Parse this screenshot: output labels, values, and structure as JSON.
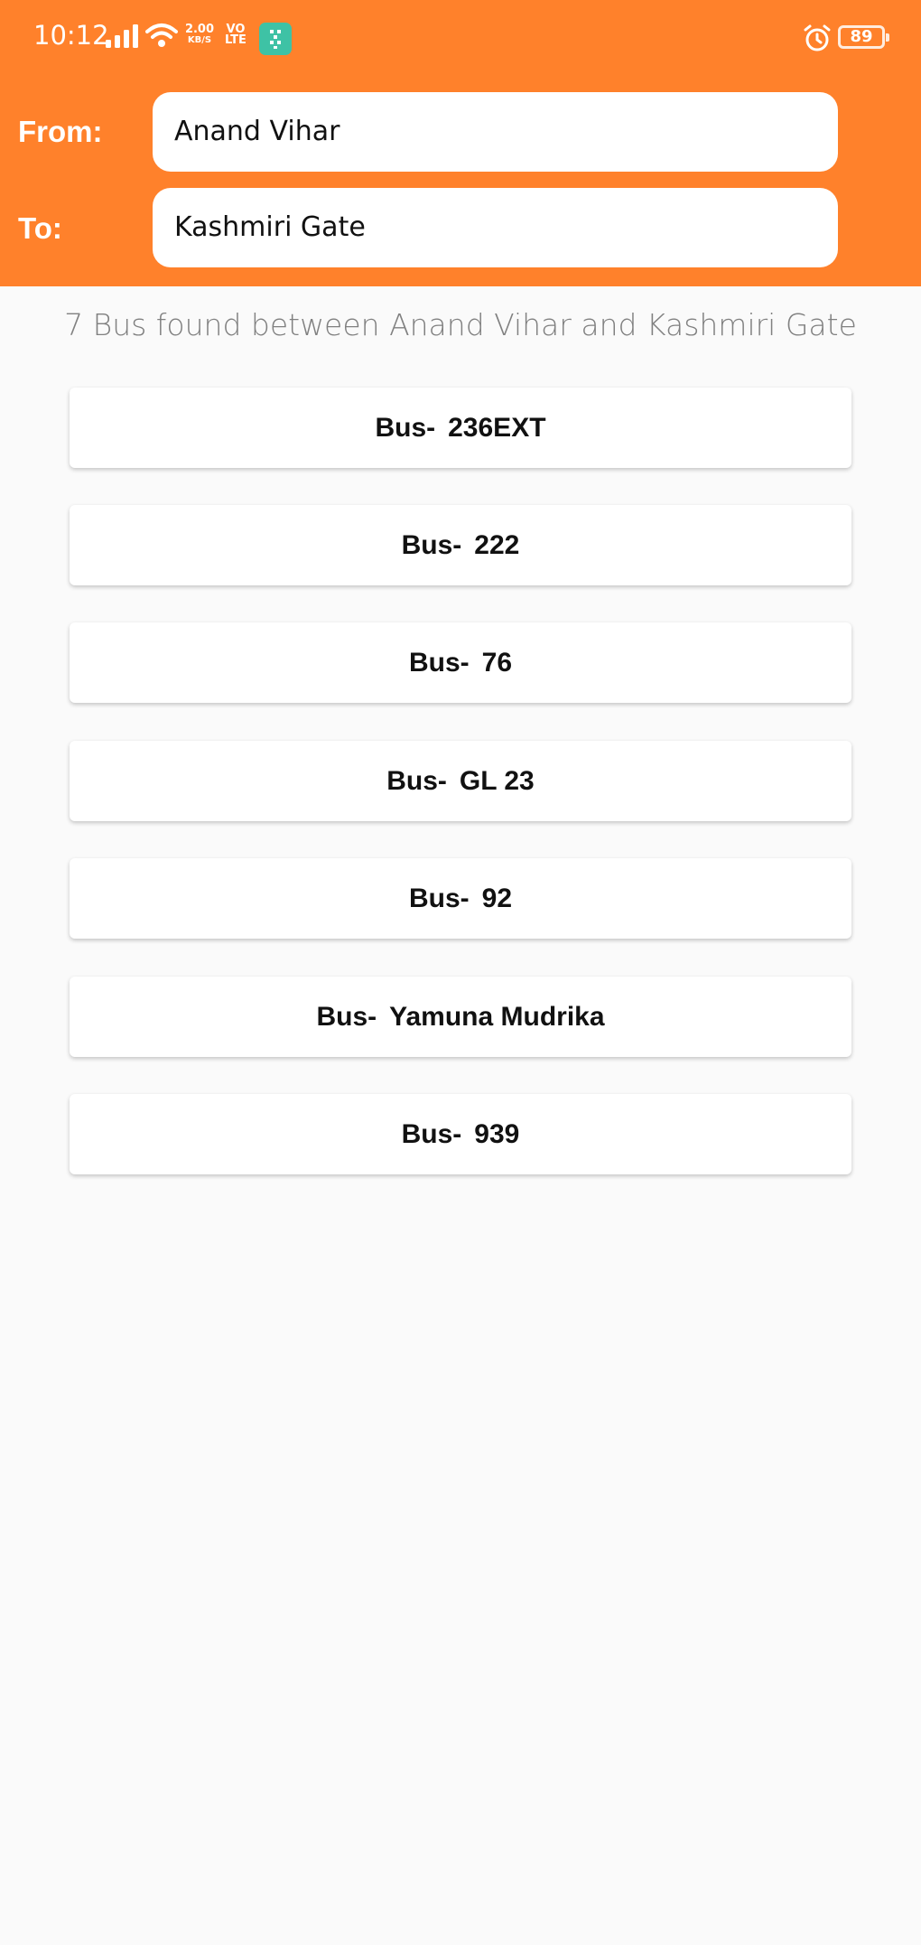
{
  "status_bar": {
    "time": "10:12",
    "speed_value": "2.00",
    "speed_unit": "KB/S",
    "volte_top": "VO",
    "volte_bottom": "LTE",
    "battery": "89"
  },
  "form": {
    "from_label": "From:",
    "from_value": "Anand Vihar",
    "to_label": "To:",
    "to_value": "Kashmiri Gate"
  },
  "summary": "7 Bus found between Anand Vihar and Kashmiri Gate",
  "bus_prefix": "Bus-",
  "buses": [
    {
      "number": "236EXT"
    },
    {
      "number": "222"
    },
    {
      "number": "76"
    },
    {
      "number": "GL 23"
    },
    {
      "number": "92"
    },
    {
      "number": "Yamuna Mudrika"
    },
    {
      "number": "939"
    }
  ],
  "colors": {
    "header": "#ff812b",
    "background": "#fafafa",
    "app_icon": "#3ec2a5"
  }
}
